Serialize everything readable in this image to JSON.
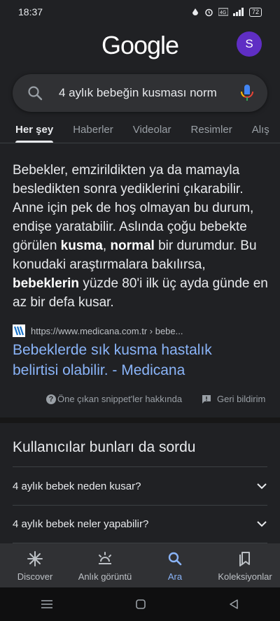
{
  "status": {
    "time": "18:37",
    "battery": "72"
  },
  "logo": "Google",
  "avatar": "S",
  "search": {
    "query": "4 aylık bebeğin kusması norm"
  },
  "tabs": [
    "Her şey",
    "Haberler",
    "Videolar",
    "Resimler",
    "Alış"
  ],
  "snippet": {
    "p1": "Bebekler, emzirildikten ya da mamayla besledikten sonra yediklerini çıkarabilir. Anne için pek de hoş olmayan bu durum, endişe yaratabilir. Aslında çoğu bebekte görülen ",
    "b1": "kusma",
    "p2": ", ",
    "b2": "normal",
    "p3": " bir durumdur. Bu konudaki araştırmalara bakılırsa, ",
    "b3": "bebeklerin",
    "p4": " yüzde 80'i ilk üç ayda günde en az bir defa kusar."
  },
  "source": {
    "url": "https://www.medicana.com.tr › bebe..."
  },
  "result": {
    "title": "Bebeklerde sık kusma hastalık belirtisi olabilir. - Medicana"
  },
  "snippet_footer": {
    "about": "Öne çıkan snippet'ler hakkında",
    "feedback": "Geri bildirim"
  },
  "paa": {
    "title": "Kullanıcılar bunları da sordu",
    "items": [
      "4 aylık bebek neden kusar?",
      "4 aylık bebek neler yapabilir?"
    ]
  },
  "bottom_nav": [
    "Discover",
    "Anlık görüntü",
    "Ara",
    "Koleksiyonlar"
  ],
  "colors": {
    "accent": "#8ab4f8",
    "background": "#202124",
    "avatar": "#5f2ec4"
  }
}
